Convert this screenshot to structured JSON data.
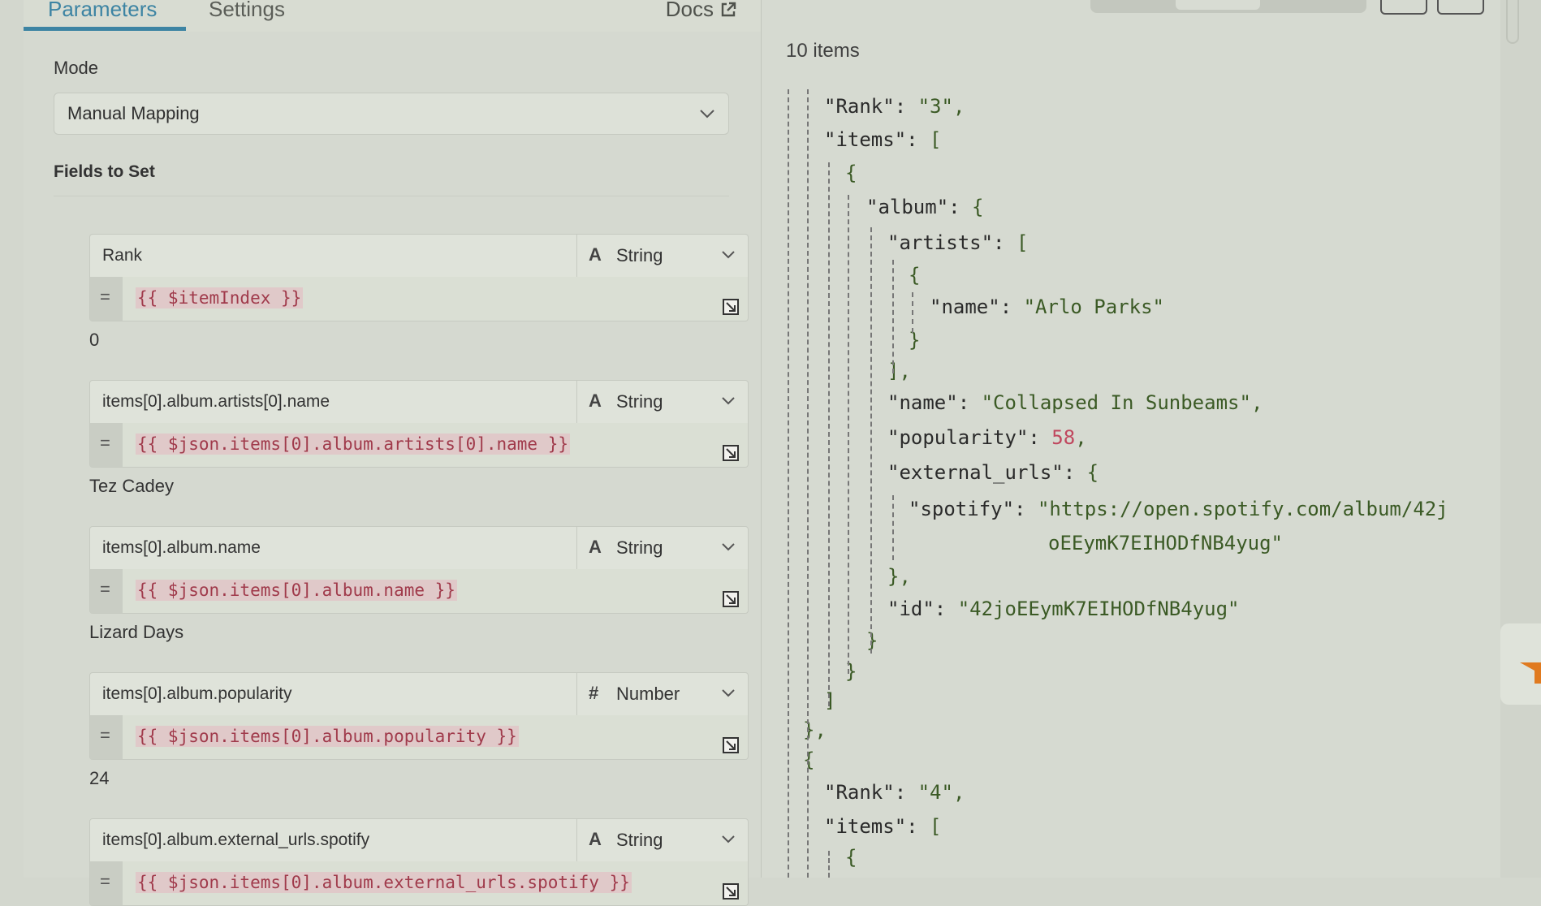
{
  "tabs": {
    "parameters": "Parameters",
    "settings": "Settings",
    "docs": "Docs"
  },
  "mode": {
    "label": "Mode",
    "value": "Manual Mapping"
  },
  "fields_label": "Fields to Set",
  "fields": [
    {
      "name": "Rank",
      "type_icon": "A",
      "type": "String",
      "expr": "{{ $itemIndex }}",
      "result": "0"
    },
    {
      "name": "items[0].album.artists[0].name",
      "type_icon": "A",
      "type": "String",
      "expr": "{{ $json.items[0].album.artists[0].name }}",
      "result": "Tez Cadey"
    },
    {
      "name": "items[0].album.name",
      "type_icon": "A",
      "type": "String",
      "expr": "{{ $json.items[0].album.name }}",
      "result": "Lizard Days"
    },
    {
      "name": "items[0].album.popularity",
      "type_icon": "#",
      "type": "Number",
      "expr": "{{ $json.items[0].album.popularity }}",
      "result": "24"
    },
    {
      "name": "items[0].album.external_urls.spotify",
      "type_icon": "A",
      "type": "String",
      "expr": "{{ $json.items[0].album.external_urls.spotify }}",
      "result": ""
    }
  ],
  "output": {
    "items_count": "10 items",
    "json_lines": [
      {
        "text": "\"Rank\": ",
        "value": "\"3\"",
        "vtype": "s",
        "tail": ","
      },
      {
        "text": "\"items\": ",
        "value": "[",
        "vtype": "p",
        "tail": ""
      },
      {
        "text": "",
        "value": "{",
        "vtype": "p",
        "tail": ""
      },
      {
        "text": "\"album\": ",
        "value": "{",
        "vtype": "p",
        "tail": ""
      },
      {
        "text": "\"artists\": ",
        "value": "[",
        "vtype": "p",
        "tail": ""
      },
      {
        "text": "",
        "value": "{",
        "vtype": "p",
        "tail": ""
      },
      {
        "text": "\"name\": ",
        "value": "\"Arlo Parks\"",
        "vtype": "s",
        "tail": ""
      },
      {
        "text": "",
        "value": "}",
        "vtype": "p",
        "tail": ""
      },
      {
        "text": "",
        "value": "],",
        "vtype": "p",
        "tail": ""
      },
      {
        "text": "\"name\": ",
        "value": "\"Collapsed In Sunbeams\"",
        "vtype": "s",
        "tail": ","
      },
      {
        "text": "\"popularity\": ",
        "value": "58",
        "vtype": "n",
        "tail": ","
      },
      {
        "text": "\"external_urls\": ",
        "value": "{",
        "vtype": "p",
        "tail": ""
      },
      {
        "text": "\"spotify\": ",
        "value": "\"https://open.spotify.com/album/42j",
        "vtype": "s",
        "tail": ""
      },
      {
        "text": "",
        "value": "oEEymK7EIHODfNB4yug\"",
        "vtype": "s",
        "tail": ""
      },
      {
        "text": "",
        "value": "},",
        "vtype": "p",
        "tail": ""
      },
      {
        "text": "\"id\": ",
        "value": "\"42joEEymK7EIHODfNB4yug\"",
        "vtype": "s",
        "tail": ""
      },
      {
        "text": "",
        "value": "}",
        "vtype": "p",
        "tail": ""
      },
      {
        "text": "",
        "value": "}",
        "vtype": "p",
        "tail": ""
      },
      {
        "text": "",
        "value": "]",
        "vtype": "p",
        "tail": ""
      },
      {
        "text": "",
        "value": "},",
        "vtype": "p",
        "tail": ""
      },
      {
        "text": "",
        "value": "{",
        "vtype": "p",
        "tail": ""
      },
      {
        "text": "\"Rank\": ",
        "value": "\"4\"",
        "vtype": "s",
        "tail": ","
      },
      {
        "text": "\"items\": ",
        "value": "[",
        "vtype": "p",
        "tail": ""
      },
      {
        "text": "",
        "value": "{",
        "vtype": "p",
        "tail": ""
      }
    ]
  },
  "colors": {
    "accent": "#3d84a3",
    "expression": "#a03a4b",
    "json_string": "#3b5a25",
    "json_number": "#c0475e"
  },
  "icons": {
    "docs": "external-link-icon",
    "expand": "expand-icon",
    "chevron": "chevron-down-icon",
    "float": "filter-icon"
  }
}
